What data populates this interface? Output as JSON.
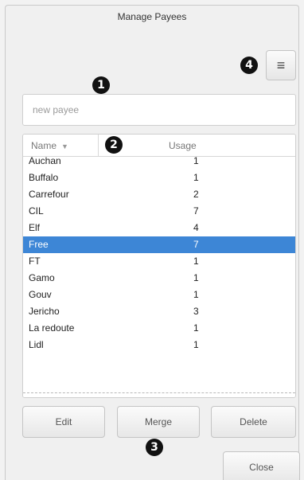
{
  "window": {
    "title": "Manage Payees"
  },
  "toolbar": {
    "menu_glyph": "≡"
  },
  "markers": {
    "m1": "1",
    "m2": "2",
    "m3": "3",
    "m4": "4"
  },
  "search": {
    "placeholder": "new payee",
    "value": ""
  },
  "list": {
    "columns": {
      "name": "Name",
      "usage": "Usage",
      "sort_indicator": "▼"
    },
    "rows": [
      {
        "name": "Auchan",
        "usage": "1"
      },
      {
        "name": "Buffalo",
        "usage": "1"
      },
      {
        "name": "Carrefour",
        "usage": "2"
      },
      {
        "name": "CIL",
        "usage": "7"
      },
      {
        "name": "Elf",
        "usage": "4"
      },
      {
        "name": "Free",
        "usage": "7",
        "selected": true
      },
      {
        "name": "FT",
        "usage": "1"
      },
      {
        "name": "Gamo",
        "usage": "1"
      },
      {
        "name": "Gouv",
        "usage": "1"
      },
      {
        "name": "Jericho",
        "usage": "3"
      },
      {
        "name": "La redoute",
        "usage": "1"
      },
      {
        "name": "Lidl",
        "usage": "1"
      }
    ]
  },
  "actions": {
    "edit": "Edit",
    "merge": "Merge",
    "delete": "Delete",
    "close": "Close"
  },
  "colors": {
    "selection": "#3d86d6",
    "marker": "#111111"
  }
}
